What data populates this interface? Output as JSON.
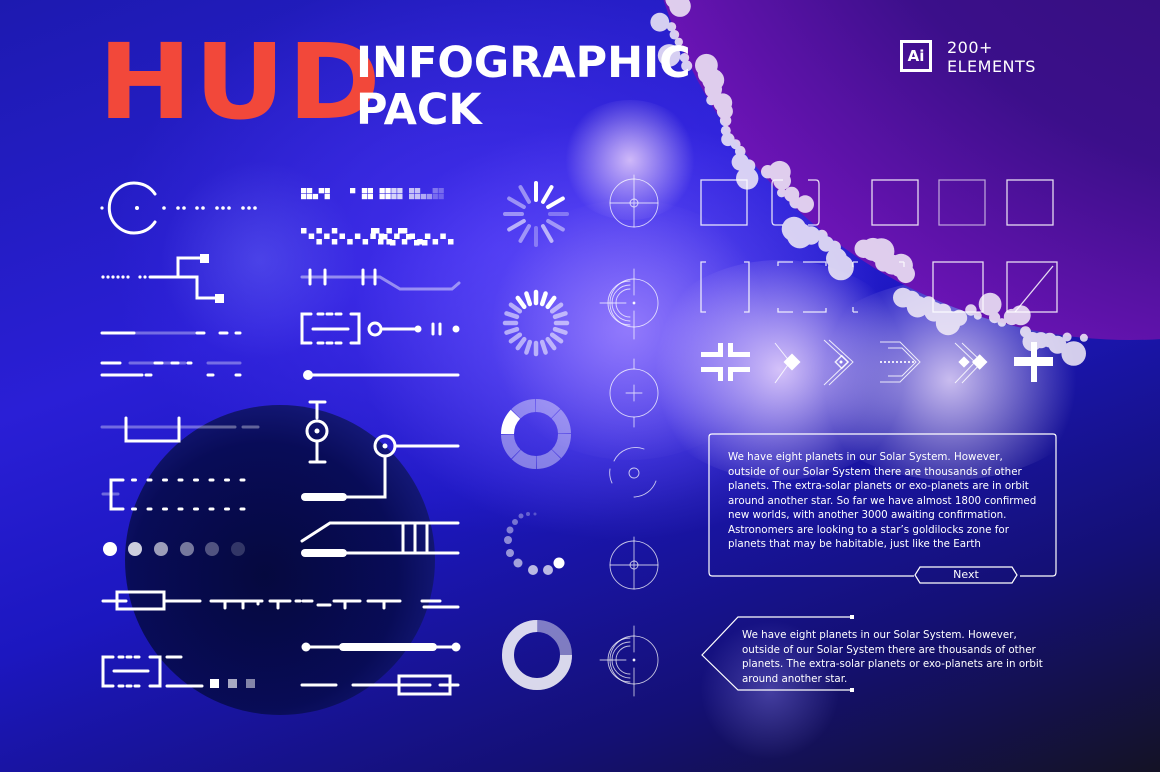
{
  "header": {
    "title_main": "HUD",
    "title_line1": "INFOGRAPHIC",
    "title_line2": "PACK",
    "badge_icon_label": "Ai",
    "count_line1": "200+",
    "count_line2": "ELEMENTS"
  },
  "colors": {
    "accent_red": "#f2483a",
    "foreground": "#ffffff",
    "background_blue": "#2a1fd6",
    "planet_magenta": "#c21ad8"
  },
  "panels": {
    "large_text": "We have eight planets in our Solar System. However, outside of our Solar System there are thousands of other planets. The extra-solar planets or exo-planets are in orbit around another star. So far we have almost 1800 confirmed new worlds, with another 3000 awaiting confirmation. Astronomers are looking to a star’s goldilocks zone for planets that may be habitable, just like the Earth",
    "next_label": "Next",
    "small_text": "We have eight planets in our Solar System. However, outside of our Solar System there are thousands of other planets. The extra-solar planets or exo-planets are in orbit around another star."
  },
  "icons": {
    "loaders": [
      "spinner-lines-icon",
      "spinner-ring-icon",
      "segment-ring-icon",
      "dot-spinner-icon",
      "progress-ring-icon"
    ],
    "crosshairs": [
      "crosshair-1-icon",
      "crosshair-2-icon",
      "crosshair-3-icon",
      "crosshair-4-icon",
      "crosshair-5-icon",
      "crosshair-6-icon"
    ],
    "frames": [
      "frame-corner-icon",
      "frame-bracket-icon",
      "frame-square-icon",
      "frame-tick-icon",
      "frame-plain-icon"
    ],
    "arrows": [
      "converge-icon",
      "arrow-diamond-icon",
      "arrow-target-icon",
      "arrow-speed-icon",
      "arrow-double-icon",
      "cross-icon"
    ]
  },
  "progress": {
    "segment_ring_filled_fraction": 0.125,
    "progress_ring_filled_fraction": 0.75
  }
}
